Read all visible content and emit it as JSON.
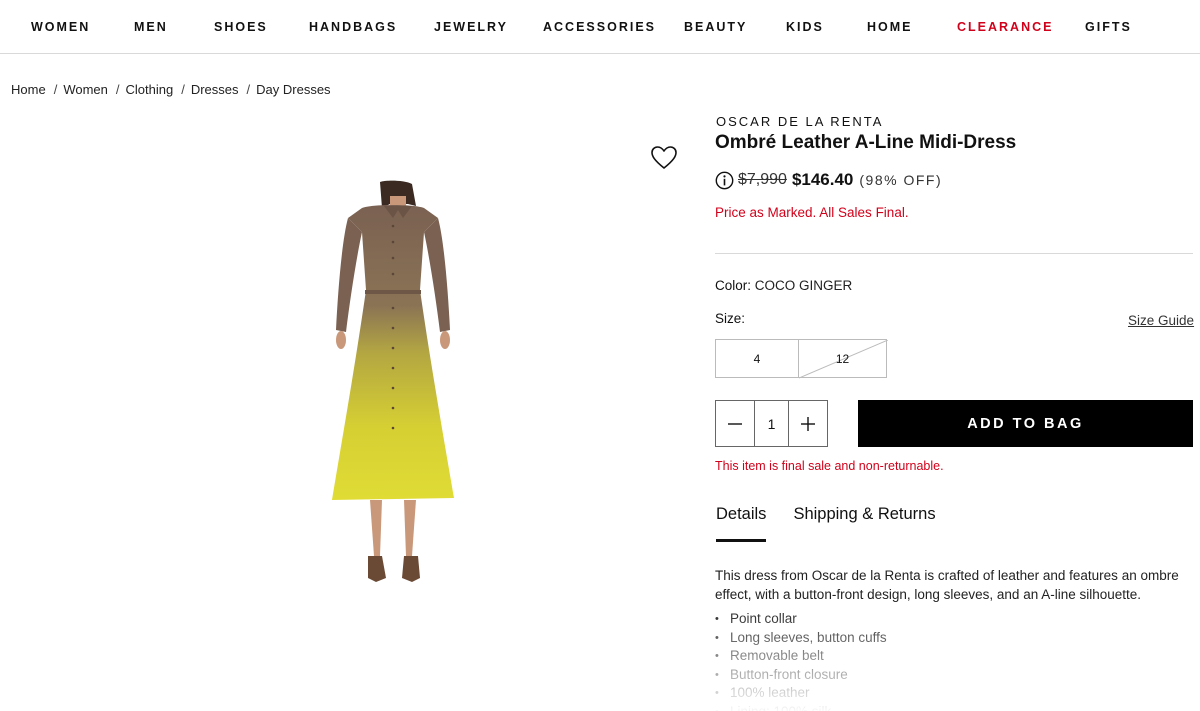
{
  "nav": {
    "items": [
      "WOMEN",
      "MEN",
      "SHOES",
      "HANDBAGS",
      "JEWELRY",
      "ACCESSORIES",
      "BEAUTY",
      "KIDS",
      "HOME",
      "CLEARANCE",
      "GIFTS"
    ],
    "highlight_item": "CLEARANCE",
    "highlight_color": "#d0021b"
  },
  "breadcrumb": [
    "Home",
    "Women",
    "Clothing",
    "Dresses",
    "Day Dresses"
  ],
  "product": {
    "brand": "OSCAR DE LA RENTA",
    "title": "Ombré Leather A-Line Midi-Dress",
    "original_price": "$7,990",
    "sale_price": "$146.40",
    "discount": "(98% OFF)",
    "notice": "Price as Marked. All Sales Final.",
    "color_label": "Color:",
    "color_value": "COCO GINGER",
    "size_label": "Size:",
    "size_guide": "Size Guide",
    "sizes": [
      {
        "label": "4",
        "available": true
      },
      {
        "label": "12",
        "available": false
      }
    ],
    "quantity": "1",
    "add_to_bag": "ADD TO BAG",
    "final_sale_note": "This item is final sale and non-returnable.",
    "wishlist_icon": "heart-icon",
    "info_icon": "info-icon"
  },
  "tabs": [
    {
      "label": "Details",
      "active": true
    },
    {
      "label": "Shipping & Returns",
      "active": false
    }
  ],
  "details": {
    "description": "This dress from Oscar de la Renta is crafted of leather and features an ombre effect, with a button-front design, long sleeves, and an A-line silhouette.",
    "bullets": [
      "Point collar",
      "Long sleeves, button cuffs",
      "Removable belt",
      "Button-front closure",
      "100% leather",
      "Lining: 100% silk"
    ]
  },
  "colors": {
    "accent_red": "#d0021b",
    "button_black": "#000000",
    "dress_top": "#7d6453",
    "dress_bottom": "#dcd62e"
  }
}
